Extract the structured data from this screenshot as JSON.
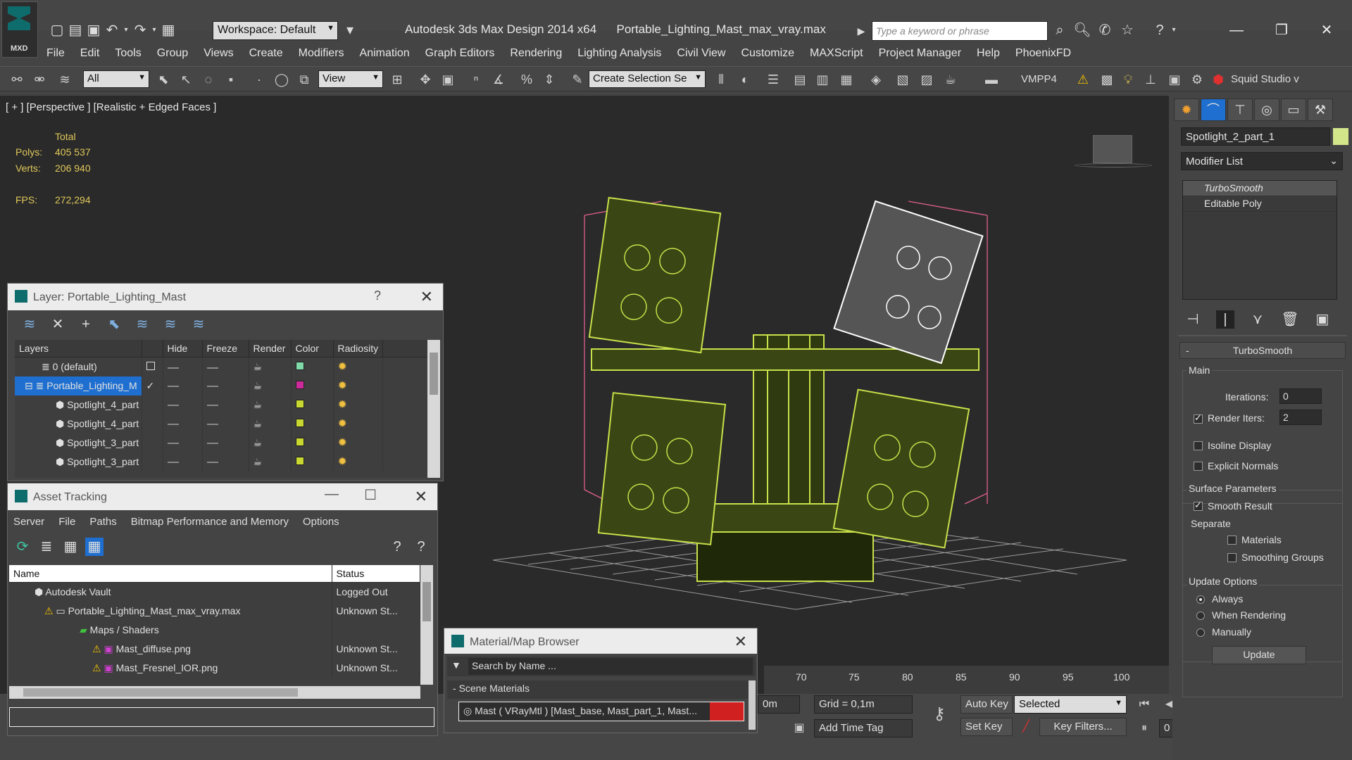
{
  "app": {
    "logo_label": "MXD",
    "title": "Autodesk 3ds Max Design 2014 x64      Portable_Lighting_Mast_max_vray.max",
    "workspace": "Workspace: Default",
    "search_placeholder": "Type a keyword or phrase"
  },
  "menu": [
    "File",
    "Edit",
    "Tools",
    "Group",
    "Views",
    "Create",
    "Modifiers",
    "Animation",
    "Graph Editors",
    "Rendering",
    "Lighting Analysis",
    "Civil View",
    "Customize",
    "MAXScript",
    "Project Manager",
    "Help",
    "PhoenixFD"
  ],
  "toolbar": {
    "filter": "All",
    "ref_coord": "View",
    "selection_set": "Create Selection Se",
    "vmpp": "VMPP4",
    "squid": "Squid Studio v"
  },
  "viewport": {
    "label": "[ + ] [Perspective ] [Realistic + Edged Faces ]",
    "stats": {
      "total_label": "Total",
      "polys_label": "Polys:",
      "polys": "405 537",
      "verts_label": "Verts:",
      "verts": "206 940",
      "fps_label": "FPS:",
      "fps": "272,294"
    }
  },
  "command_panel": {
    "object_name": "Spotlight_2_part_1",
    "object_color": "#d4e68a",
    "modifier_list": "Modifier List",
    "stack": [
      "TurboSmooth",
      "Editable Poly"
    ],
    "rollout_title": "TurboSmooth",
    "main_label": "Main",
    "iterations_label": "Iterations:",
    "iterations": "0",
    "render_iters_label": "Render Iters:",
    "render_iters": "2",
    "isoline": "Isoline Display",
    "explicit_normals": "Explicit Normals",
    "surface_params": "Surface Parameters",
    "smooth_result": "Smooth Result",
    "separate": "Separate",
    "materials": "Materials",
    "smoothing_groups": "Smoothing Groups",
    "update_options": "Update Options",
    "always": "Always",
    "when_rendering": "When Rendering",
    "manually": "Manually",
    "update_btn": "Update"
  },
  "layer_dialog": {
    "title": "Layer: Portable_Lighting_Mast",
    "help": "?",
    "columns": [
      "Layers",
      "Hide",
      "Freeze",
      "Render",
      "Color",
      "Radiosity"
    ],
    "rows": [
      {
        "name": "0 (default)",
        "color": "#7fd9a8"
      },
      {
        "name": "Portable_Lighting_M",
        "color": "#cc2a9a"
      },
      {
        "name": "Spotlight_4_part",
        "color": "#c8d830"
      },
      {
        "name": "Spotlight_4_part",
        "color": "#c8d830"
      },
      {
        "name": "Spotlight_3_part",
        "color": "#c8d830"
      },
      {
        "name": "Spotlight_3_part",
        "color": "#c8d830"
      }
    ]
  },
  "asset_dialog": {
    "title": "Asset Tracking",
    "menu": [
      "Server",
      "File",
      "Paths",
      "Bitmap Performance and Memory",
      "Options"
    ],
    "columns": [
      "Name",
      "Status"
    ],
    "rows": [
      {
        "name": "Autodesk Vault",
        "status": "Logged Out"
      },
      {
        "name": "Portable_Lighting_Mast_max_vray.max",
        "status": "Unknown St..."
      },
      {
        "name": "Maps / Shaders",
        "status": ""
      },
      {
        "name": "Mast_diffuse.png",
        "status": "Unknown St..."
      },
      {
        "name": "Mast_Fresnel_IOR.png",
        "status": "Unknown St..."
      }
    ]
  },
  "material_browser": {
    "title": "Material/Map Browser",
    "search_placeholder": "Search by Name ...",
    "section": "Scene Materials",
    "item": "Mast ( VRayMtl ) [Mast_base, Mast_part_1, Mast..."
  },
  "timeline": {
    "ticks": [
      "70",
      "75",
      "80",
      "85",
      "90",
      "95",
      "100"
    ]
  },
  "statusbar": {
    "coord_field": "0m",
    "grid": "Grid = 0,1m",
    "add_time_tag": "Add Time Tag",
    "auto_key": "Auto Key",
    "set_key": "Set Key",
    "selected": "Selected",
    "key_filters": "Key Filters...",
    "frame": "0"
  },
  "colors": {
    "wire": "#c8e04a",
    "wire_selected": "#ffffff",
    "bbox": "#e06090",
    "viewport_bg": "#2a2a2a",
    "highlight": "#1f6fd0"
  },
  "icons": [
    "save-icon",
    "undo-icon",
    "redo-icon",
    "search-icon",
    "close-icon",
    "help-icon",
    "star-icon",
    "key-icon",
    "bulb-icon",
    "warning-icon"
  ]
}
